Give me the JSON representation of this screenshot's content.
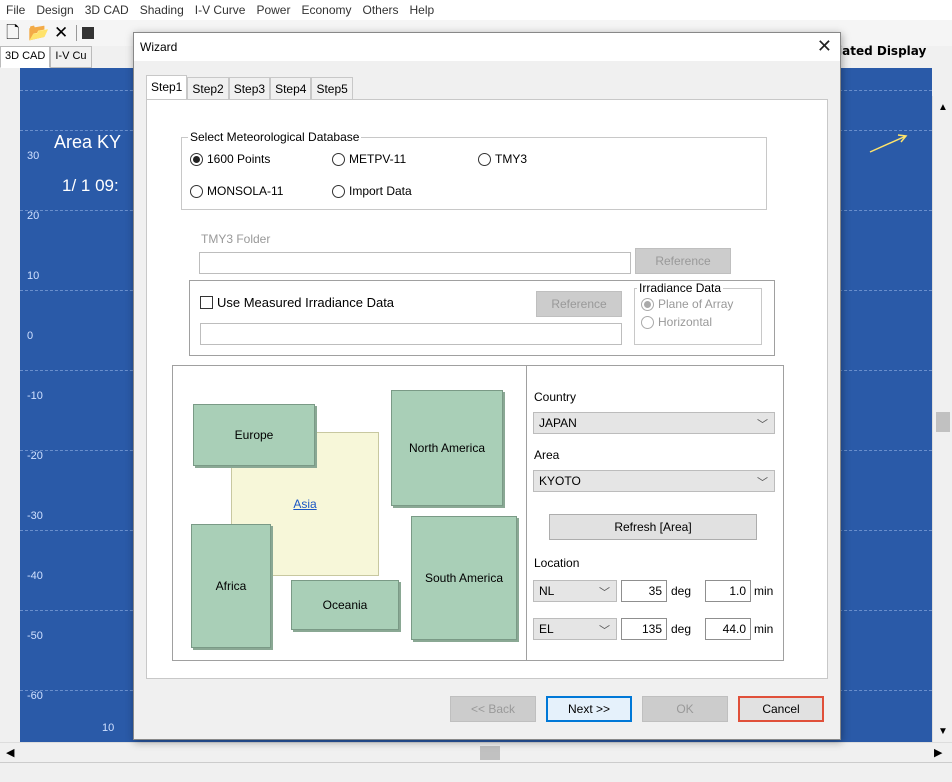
{
  "menubar": [
    "File",
    "Design",
    "3D CAD",
    "Shading",
    "I-V Curve",
    "Power",
    "Economy",
    "Others",
    "Help"
  ],
  "app_tabs": [
    "3D CAD",
    "I-V Cu"
  ],
  "right_label": "iated Display",
  "canvas": {
    "title1": "Area KY",
    "title2": "1/ 1 09:",
    "y_labels": [
      "30",
      "20",
      "10",
      "0",
      "-10",
      "-20",
      "-30",
      "-40",
      "-50",
      "-60",
      "10"
    ]
  },
  "wizard": {
    "title": "Wizard",
    "tabs": [
      "Step1",
      "Step2",
      "Step3",
      "Step4",
      "Step5"
    ],
    "db_group": {
      "legend": "Select Meteorological Database",
      "options": [
        "1600 Points",
        "METPV-11",
        "TMY3",
        "MONSOLA-11",
        "Import Data"
      ],
      "selected": "1600 Points"
    },
    "tmy3_folder_label": "TMY3 Folder",
    "reference_label": "Reference",
    "measured_label": "Use Measured Irradiance Data",
    "irradiance": {
      "legend": "Irradiance Data",
      "options": [
        "Plane of Array",
        "Horizontal"
      ],
      "selected": "Plane of Array"
    },
    "regions": {
      "europe": "Europe",
      "north_america": "North America",
      "asia": "Asia",
      "africa": "Africa",
      "south_america": "South America",
      "oceania": "Oceania"
    },
    "country_label": "Country",
    "country_value": "JAPAN",
    "area_label": "Area",
    "area_value": "KYOTO",
    "refresh_label": "Refresh [Area]",
    "location_label": "Location",
    "lat": {
      "dir": "NL",
      "deg": "35",
      "deg_unit": "deg",
      "min": "1.0",
      "min_unit": "min"
    },
    "lon": {
      "dir": "EL",
      "deg": "135",
      "deg_unit": "deg",
      "min": "44.0",
      "min_unit": "min"
    },
    "buttons": {
      "back": "<< Back",
      "next": "Next >>",
      "ok": "OK",
      "cancel": "Cancel"
    }
  },
  "colors": {
    "canvas_bg": "#2a5aa8",
    "region_green": "#a9cfb7",
    "asia_bg": "#f7f7d9",
    "cancel_border": "#e0503a",
    "next_border": "#0078d7"
  }
}
